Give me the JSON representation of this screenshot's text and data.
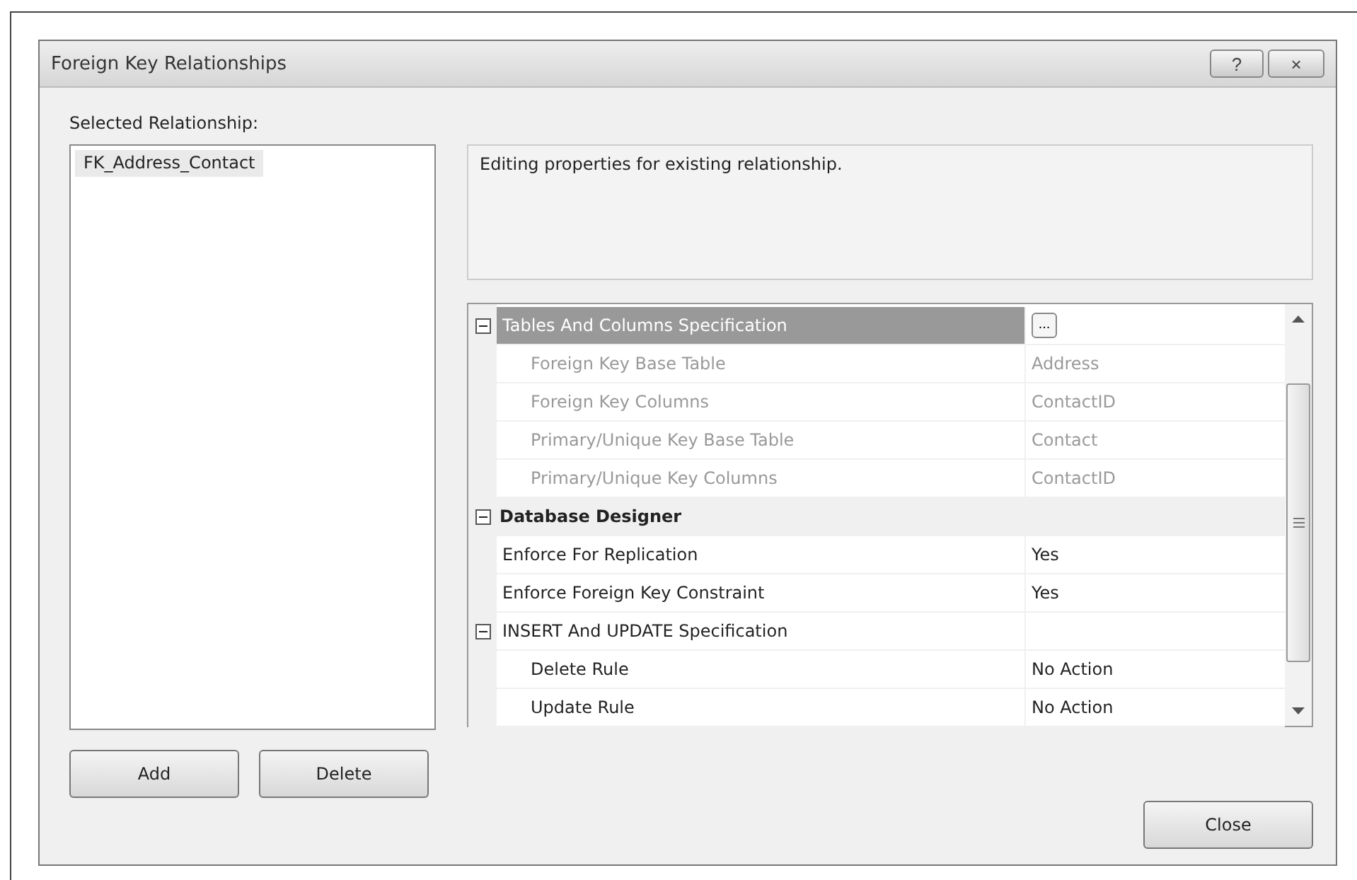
{
  "window": {
    "title": "Foreign Key Relationships",
    "buttons": [
      "?",
      "×"
    ]
  },
  "list_label": "Selected Relationship:",
  "relationships": [
    {
      "label": "FK_Address_Contact",
      "selected": true
    }
  ],
  "description": "Editing properties for existing relationship.",
  "properties": [
    {
      "kind": "property",
      "name": "Tables And Columns Specification",
      "expanded": true,
      "selected": true,
      "ellipsis": "...",
      "children": [
        {
          "kind": "property",
          "name": "Foreign Key Base Table",
          "value": "Address",
          "disabled": true,
          "selected": false
        },
        {
          "kind": "property",
          "name": "Foreign Key Columns",
          "value": "ContactID",
          "disabled": true,
          "selected": false
        },
        {
          "kind": "property",
          "name": "Primary/Unique Key Base Table",
          "value": "Contact",
          "disabled": true,
          "selected": false
        },
        {
          "kind": "property",
          "name": "Primary/Unique Key Columns",
          "value": "ContactID",
          "disabled": true,
          "selected": false
        }
      ]
    },
    {
      "kind": "category",
      "name": "Database Designer",
      "expanded": true,
      "children": [
        {
          "kind": "property",
          "name": "Enforce For Replication",
          "value": "Yes",
          "disabled": false,
          "selected": false
        },
        {
          "kind": "property",
          "name": "Enforce Foreign Key Constraint",
          "value": "Yes",
          "disabled": false,
          "selected": false
        },
        {
          "kind": "property",
          "name": "INSERT And UPDATE Specification",
          "expanded": true,
          "selected": false,
          "children": [
            {
              "kind": "property",
              "name": "Delete Rule",
              "value": "No Action",
              "disabled": false,
              "selected": false
            },
            {
              "kind": "property",
              "name": "Update Rule",
              "value": "No Action",
              "disabled": false,
              "selected": false
            }
          ]
        }
      ]
    }
  ],
  "buttons": {
    "add": "Add",
    "delete": "Delete",
    "close": "Close"
  }
}
